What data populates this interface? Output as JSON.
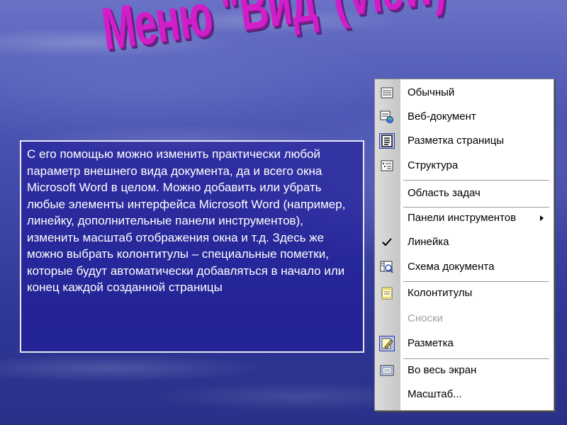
{
  "title": "Меню \"Вид\"(View)",
  "description": "С его помощью можно изменить практически любой параметр внешнего вида документа, да и всего окна Microsoft Word в целом. Можно добавить или убрать любые элементы интерфейса Microsoft Word (например, линейку, дополнительные панели инструментов), изменить масштаб отображения окна и т.д. Здесь же можно выбрать колонтитулы – специальные пометки, которые будут автоматически добавляться в начало или конец каждой созданной страницы",
  "menu": {
    "items": [
      {
        "label": "Обычный",
        "icon": "normal-view-icon"
      },
      {
        "label": "Веб-документ",
        "icon": "web-layout-icon"
      },
      {
        "label": "Разметка страницы",
        "icon": "print-layout-icon",
        "active": true
      },
      {
        "label": "Структура",
        "icon": "outline-icon"
      },
      {
        "label": "Область задач",
        "icon": ""
      },
      {
        "label": "Панели инструментов",
        "icon": "",
        "submenu": true
      },
      {
        "label": "Линейка",
        "icon": "checkmark-icon",
        "checked": true
      },
      {
        "label": "Схема документа",
        "icon": "document-map-icon"
      },
      {
        "label": "Колонтитулы",
        "icon": "header-footer-icon"
      },
      {
        "label": "Сноски",
        "icon": "",
        "disabled": true
      },
      {
        "label": "Разметка",
        "icon": "markup-icon",
        "active": true
      },
      {
        "label": "Во весь экран",
        "icon": "full-screen-icon"
      },
      {
        "label": "Масштаб...",
        "icon": ""
      }
    ]
  },
  "colors": {
    "title": "#d21ec8",
    "text_box_bg": "#1e1896",
    "menu_strip": "#c6c6c6"
  }
}
